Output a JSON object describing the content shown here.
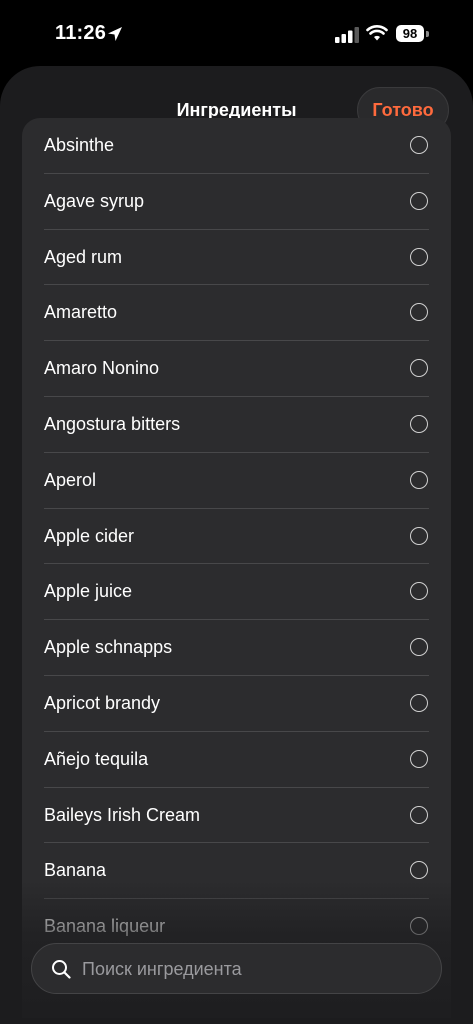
{
  "status_bar": {
    "time": "11:26",
    "battery": "98"
  },
  "sheet": {
    "title": "Ингредиенты",
    "done_label": "Готово"
  },
  "ingredients": [
    "Absinthe",
    "Agave syrup",
    "Aged rum",
    "Amaretto",
    "Amaro Nonino",
    "Angostura bitters",
    "Aperol",
    "Apple cider",
    "Apple juice",
    "Apple schnapps",
    "Apricot brandy",
    "Añejo tequila",
    "Baileys Irish Cream",
    "Banana",
    "Banana liqueur"
  ],
  "search": {
    "placeholder": "Поиск ингредиента"
  },
  "colors": {
    "accent": "#ff6a3d",
    "sheet_bg": "#1c1c1e",
    "list_bg": "#2c2c2e"
  },
  "icons": [
    "location-arrow-icon",
    "cellular-signal-icon",
    "wifi-icon",
    "battery-icon",
    "search-icon",
    "radio-unchecked-icon"
  ]
}
